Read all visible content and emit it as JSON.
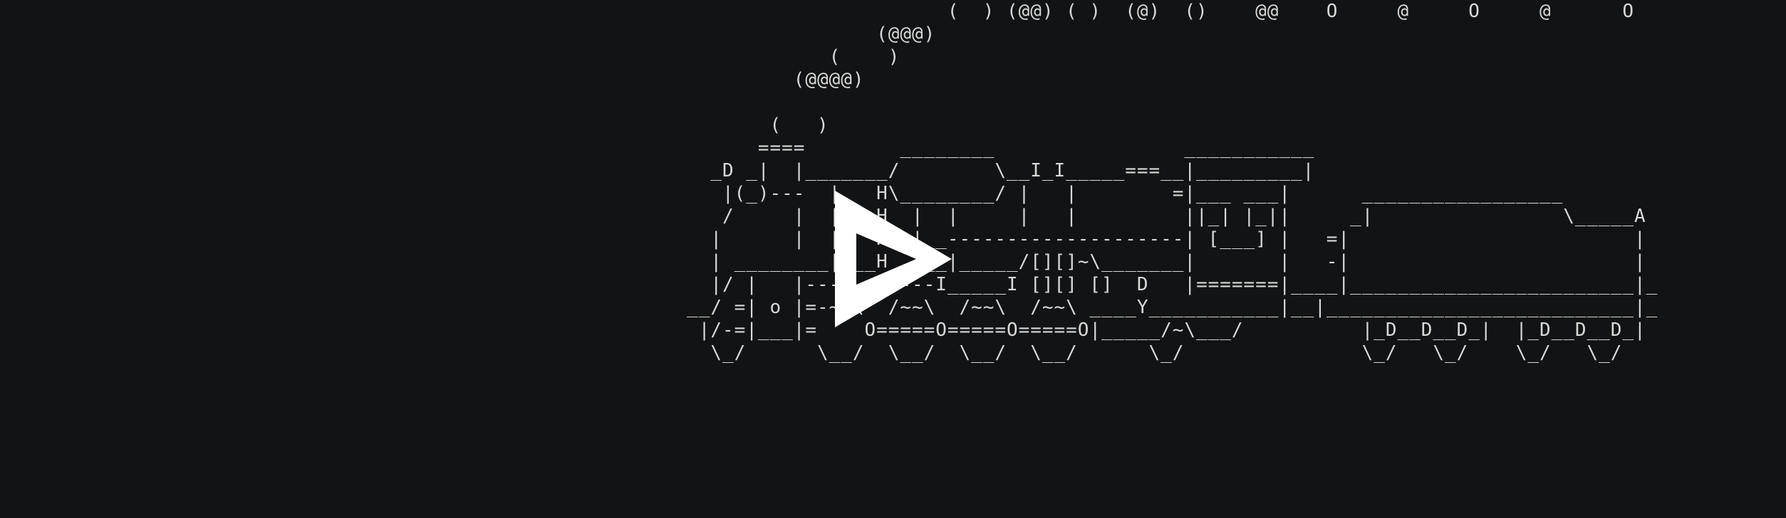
{
  "terminal": {
    "background": "#121314",
    "foreground": "#d8d8d8",
    "lines": [
      "                                                                                (  ) (@@) ( )  (@)  ()    @@    O     @     O     @      O",
      "                                                                          (@@@)",
      "                                                                      (    )",
      "                                                                   (@@@@)",
      "",
      "                                                                 (   )",
      "                                                                ====        ________                ___________",
      "                                                            _D _|  |_______/        \\__I_I_____===__|_________|",
      "                                                             |(_)---  |   H\\________/ |   |        =|___ ___|      _________________",
      "                                                             /     |  |   H  |  |     |   |         ||_| |_||     _|                \\_____A",
      "                                                            |      |  |   H  |__--------------------| [___] |   =|                        |",
      "                                                            | ________|___H__/__|_____/[][]~\\_______|       |   -|                        |",
      "                                                            |/ |   |-----------I_____I [][] []  D   |=======|____|________________________|_",
      "                                                          __/ =| o |=-~~\\  /~~\\  /~~\\  /~~\\ ____Y___________|__|__________________________|_",
      "                                                           |/-=|___|=    O=====O=====O=====O|_____/~\\___/          |_D__D__D_|  |_D__D__D_|",
      "                                                            \\_/      \\__/  \\__/  \\__/  \\__/      \\_/               \\_/   \\_/    \\_/   \\_/"
    ]
  },
  "player": {
    "play_icon": "play-icon",
    "icon_color": "#ffffff"
  }
}
